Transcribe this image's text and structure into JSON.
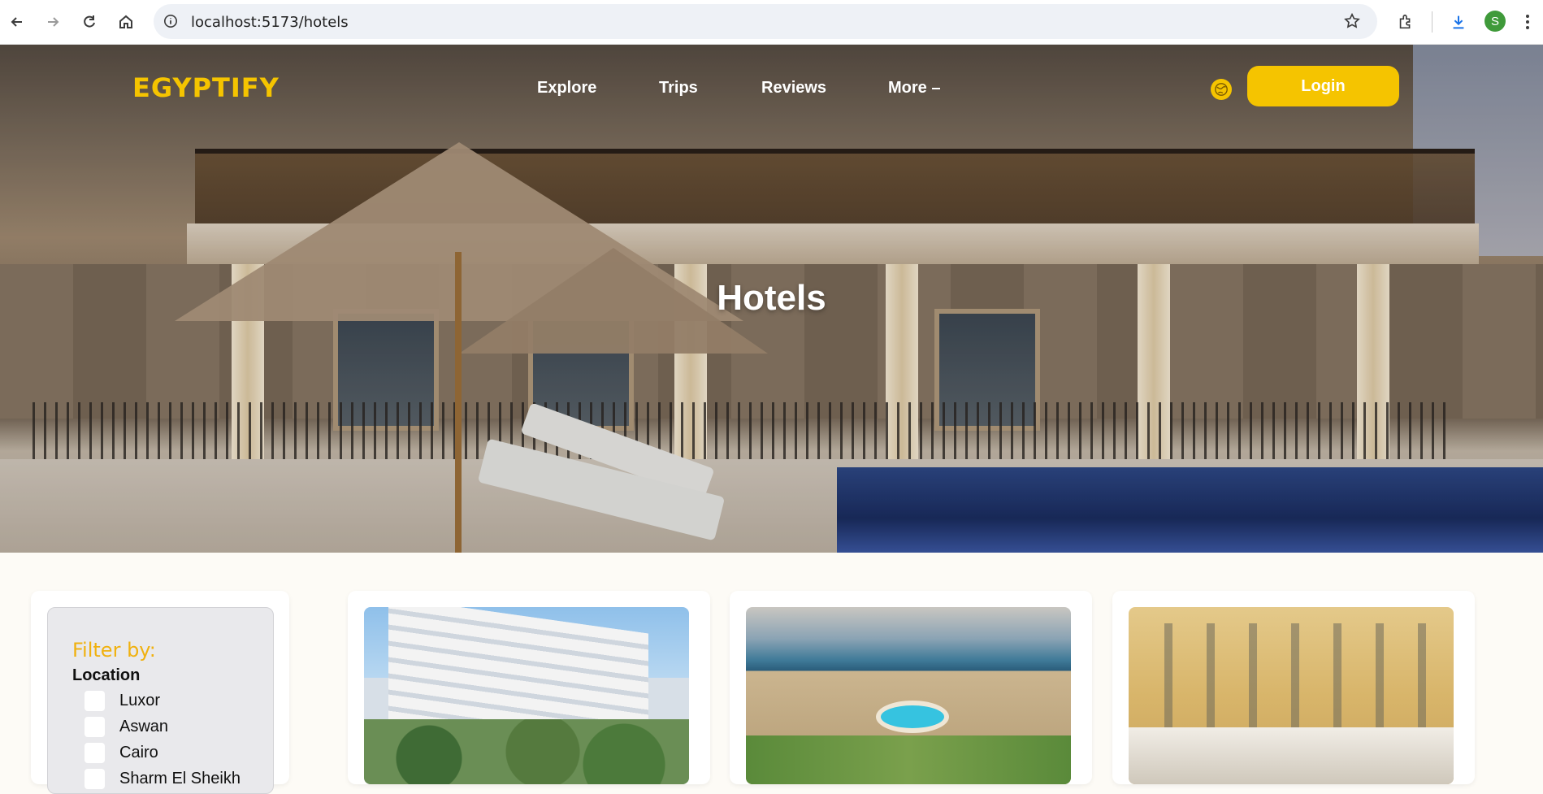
{
  "browser": {
    "url": "localhost:5173/hotels",
    "profile_initial": "S",
    "icons": [
      "back-icon",
      "forward-icon",
      "reload-icon",
      "home-icon",
      "site-info-icon",
      "bookmark-star-icon",
      "extensions-icon",
      "download-icon",
      "menu-icon"
    ]
  },
  "site": {
    "logo": "EGYPTIFY",
    "nav": [
      "Explore",
      "Trips",
      "Reviews",
      "More"
    ],
    "login": "Login",
    "accent": "#f5c400"
  },
  "hero": {
    "title": "Hotels"
  },
  "filter": {
    "title": "Filter by:",
    "group": "Location",
    "options": [
      "Luxor",
      "Aswan",
      "Cairo",
      "Sharm El Sheikh"
    ]
  }
}
